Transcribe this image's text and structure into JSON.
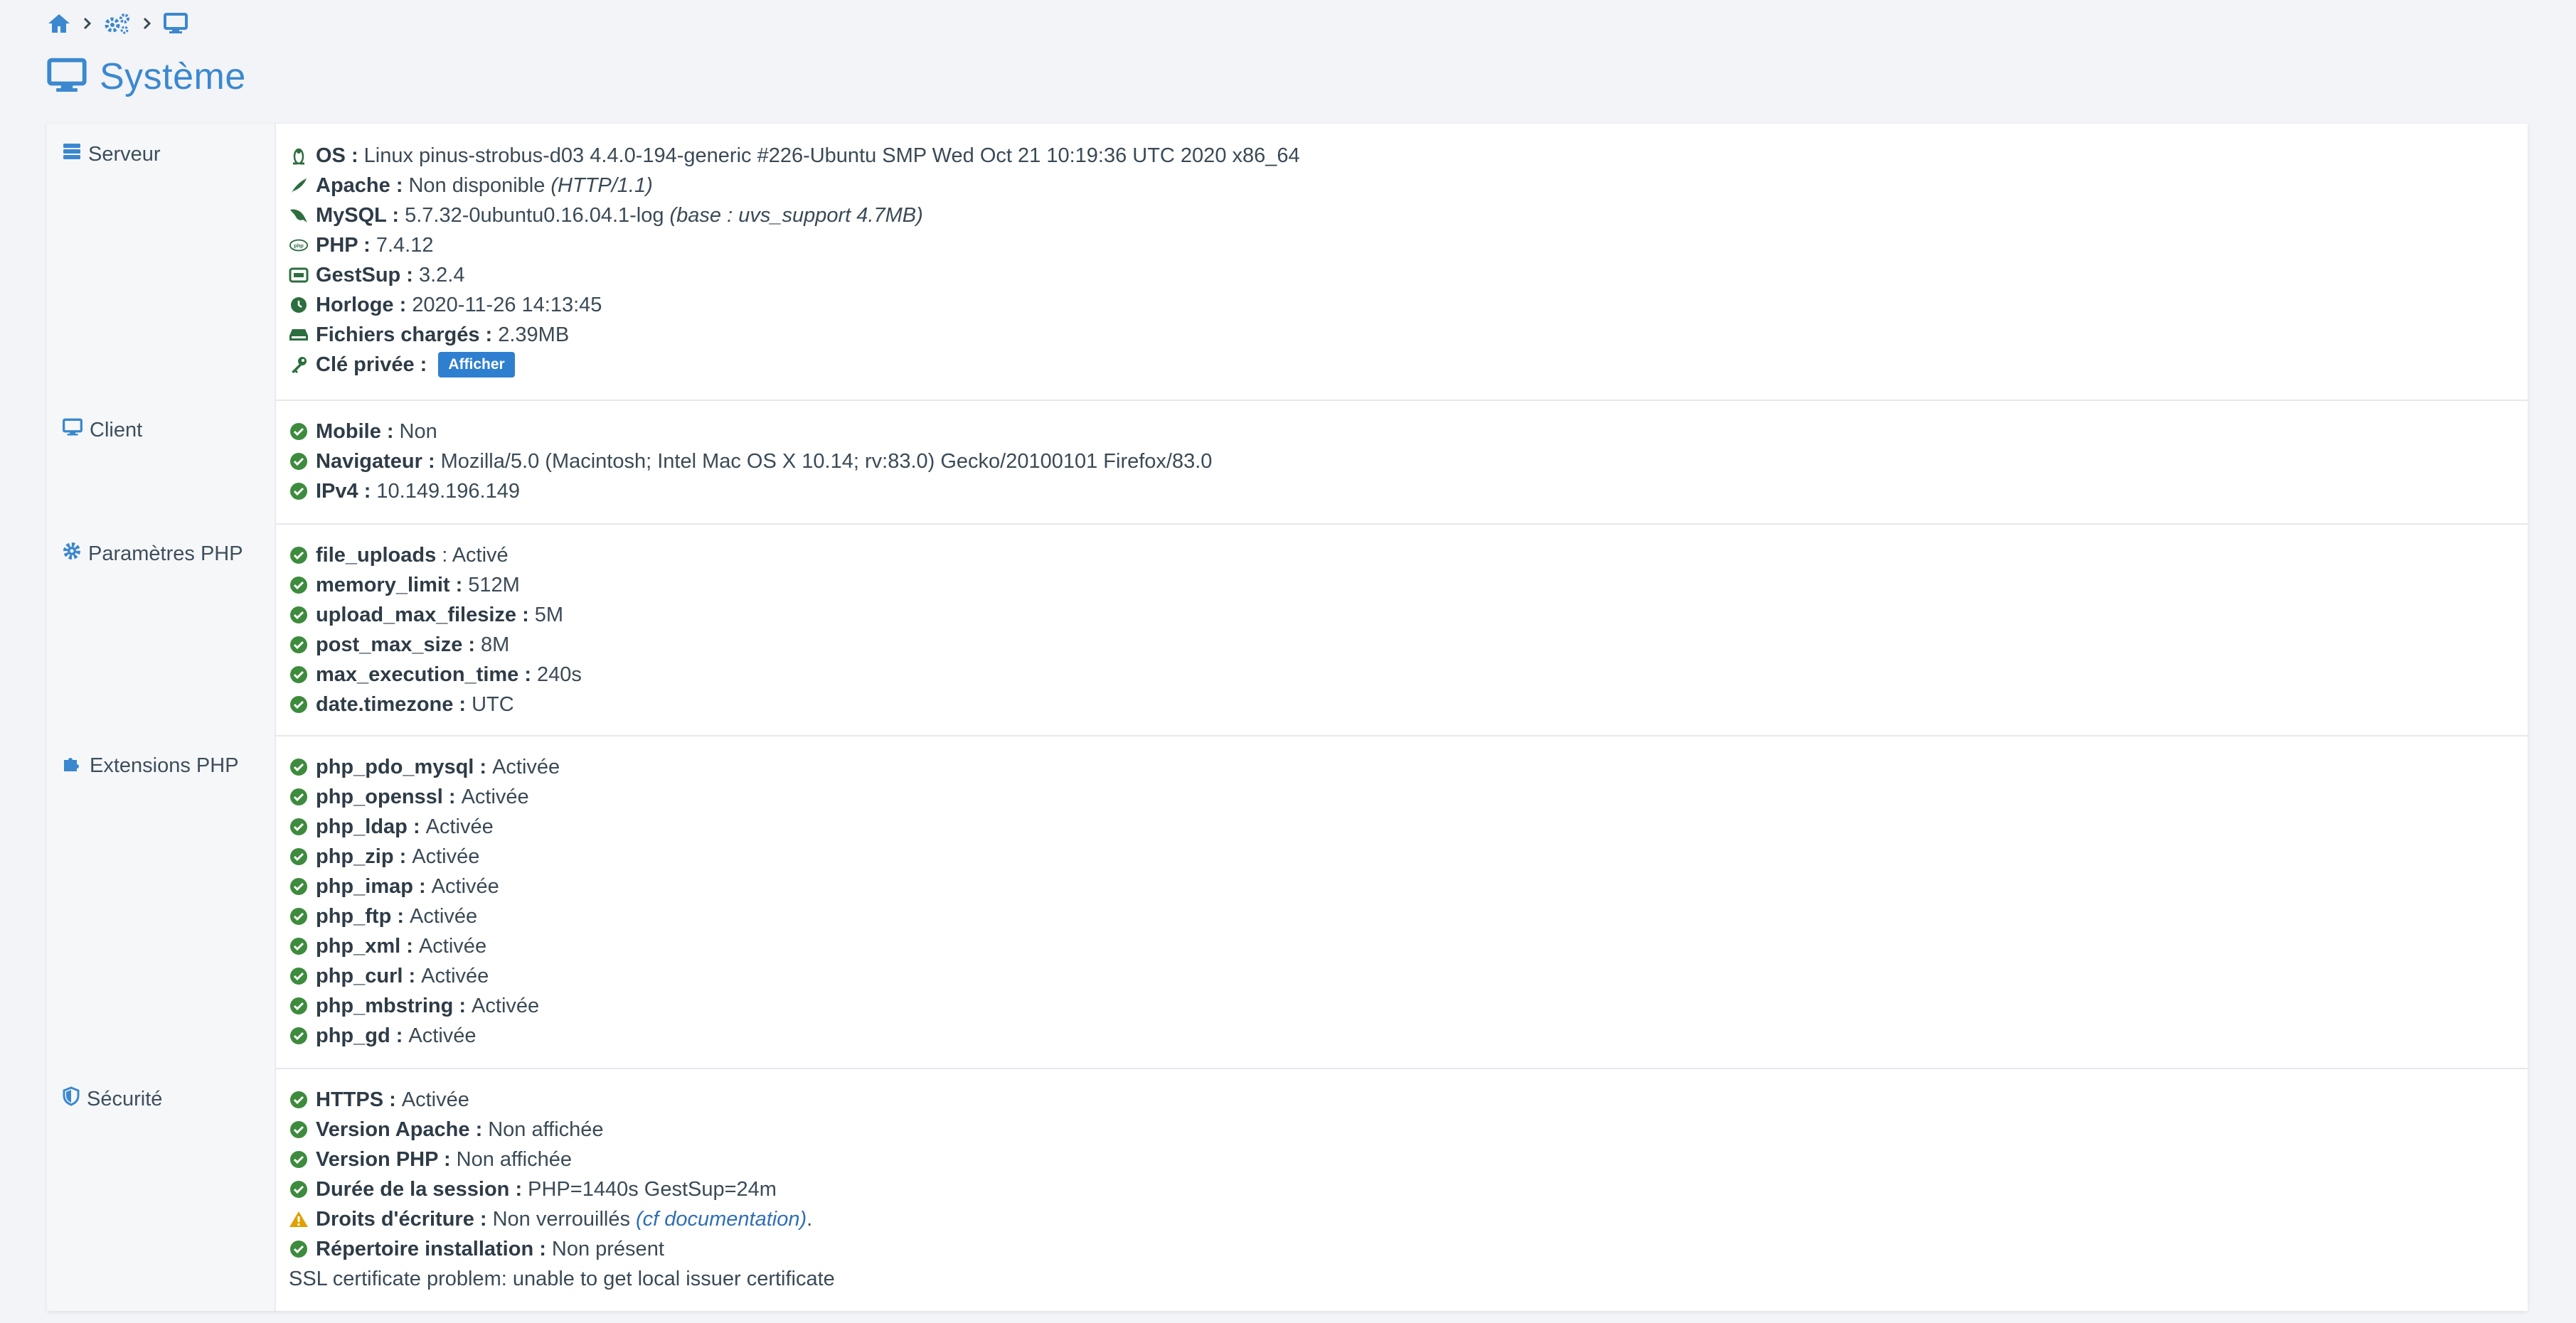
{
  "colors": {
    "accent": "#3b88cf",
    "ok": "#3d8b3d",
    "warn": "#e0a000",
    "server_icon": "#2d6e3e"
  },
  "breadcrumb": {
    "items": [
      "home-icon",
      "cogs-icon",
      "desktop-icon"
    ]
  },
  "page": {
    "title": "Système"
  },
  "sections": {
    "serveur": {
      "label": "Serveur",
      "rows": [
        {
          "key": "OS :",
          "value": "Linux pinus-strobus-d03 4.4.0-194-generic #226-Ubuntu SMP Wed Oct 21 10:19:36 UTC 2020 x86_64",
          "icon": "linux-icon"
        },
        {
          "key": "Apache :",
          "value": "Non disponible",
          "extra": "(HTTP/1.1)",
          "icon": "feather-icon"
        },
        {
          "key": "MySQL :",
          "value": "5.7.32-0ubuntu0.16.04.1-log",
          "extra": "(base : uvs_support 4.7MB)",
          "icon": "dolphin-icon"
        },
        {
          "key": "PHP :",
          "value": "7.4.12",
          "icon": "php-icon"
        },
        {
          "key": "GestSup :",
          "value": "3.2.4",
          "icon": "gestsup-icon"
        },
        {
          "key": "Horloge :",
          "value": "2020-11-26 14:13:45",
          "icon": "clock-icon"
        },
        {
          "key": "Fichiers chargés :",
          "value": "2.39MB",
          "icon": "hdd-icon"
        },
        {
          "key": "Clé privée :",
          "button": "Afficher",
          "icon": "key-icon"
        }
      ]
    },
    "client": {
      "label": "Client",
      "rows": [
        {
          "key": "Mobile :",
          "value": "Non"
        },
        {
          "key": "Navigateur :",
          "value": "Mozilla/5.0 (Macintosh; Intel Mac OS X 10.14; rv:83.0) Gecko/20100101 Firefox/83.0"
        },
        {
          "key": "IPv4 :",
          "value": "10.149.196.149"
        }
      ]
    },
    "php_params": {
      "label": "Paramètres PHP",
      "rows": [
        {
          "key": "file_uploads",
          "value": ": Activé"
        },
        {
          "key": "memory_limit :",
          "value": "512M"
        },
        {
          "key": "upload_max_filesize :",
          "value": "5M"
        },
        {
          "key": "post_max_size :",
          "value": "8M"
        },
        {
          "key": "max_execution_time :",
          "value": "240s"
        },
        {
          "key": "date.timezone :",
          "value": "UTC"
        }
      ]
    },
    "php_ext": {
      "label": "Extensions PHP",
      "rows": [
        {
          "key": "php_pdo_mysql :",
          "value": "Activée"
        },
        {
          "key": "php_openssl :",
          "value": "Activée"
        },
        {
          "key": "php_ldap :",
          "value": "Activée"
        },
        {
          "key": "php_zip :",
          "value": "Activée"
        },
        {
          "key": "php_imap :",
          "value": "Activée"
        },
        {
          "key": "php_ftp :",
          "value": "Activée"
        },
        {
          "key": "php_xml :",
          "value": "Activée"
        },
        {
          "key": "php_curl :",
          "value": "Activée"
        },
        {
          "key": "php_mbstring :",
          "value": "Activée"
        },
        {
          "key": "php_gd :",
          "value": "Activée"
        }
      ]
    },
    "securite": {
      "label": "Sécurité",
      "rows": [
        {
          "key": "HTTPS :",
          "value": "Activée"
        },
        {
          "key": "Version Apache :",
          "value": "Non affichée"
        },
        {
          "key": "Version PHP :",
          "value": "Non affichée"
        },
        {
          "key": "Durée de la session :",
          "value": "PHP=1440s GestSup=24m"
        },
        {
          "key": "Droits d'écriture :",
          "value": "Non verrouillés",
          "link": "(cf documentation)",
          "tail": "."
        },
        {
          "key": "Répertoire installation :",
          "value": "Non présent"
        }
      ],
      "note": "SSL certificate problem: unable to get local issuer certificate"
    }
  }
}
